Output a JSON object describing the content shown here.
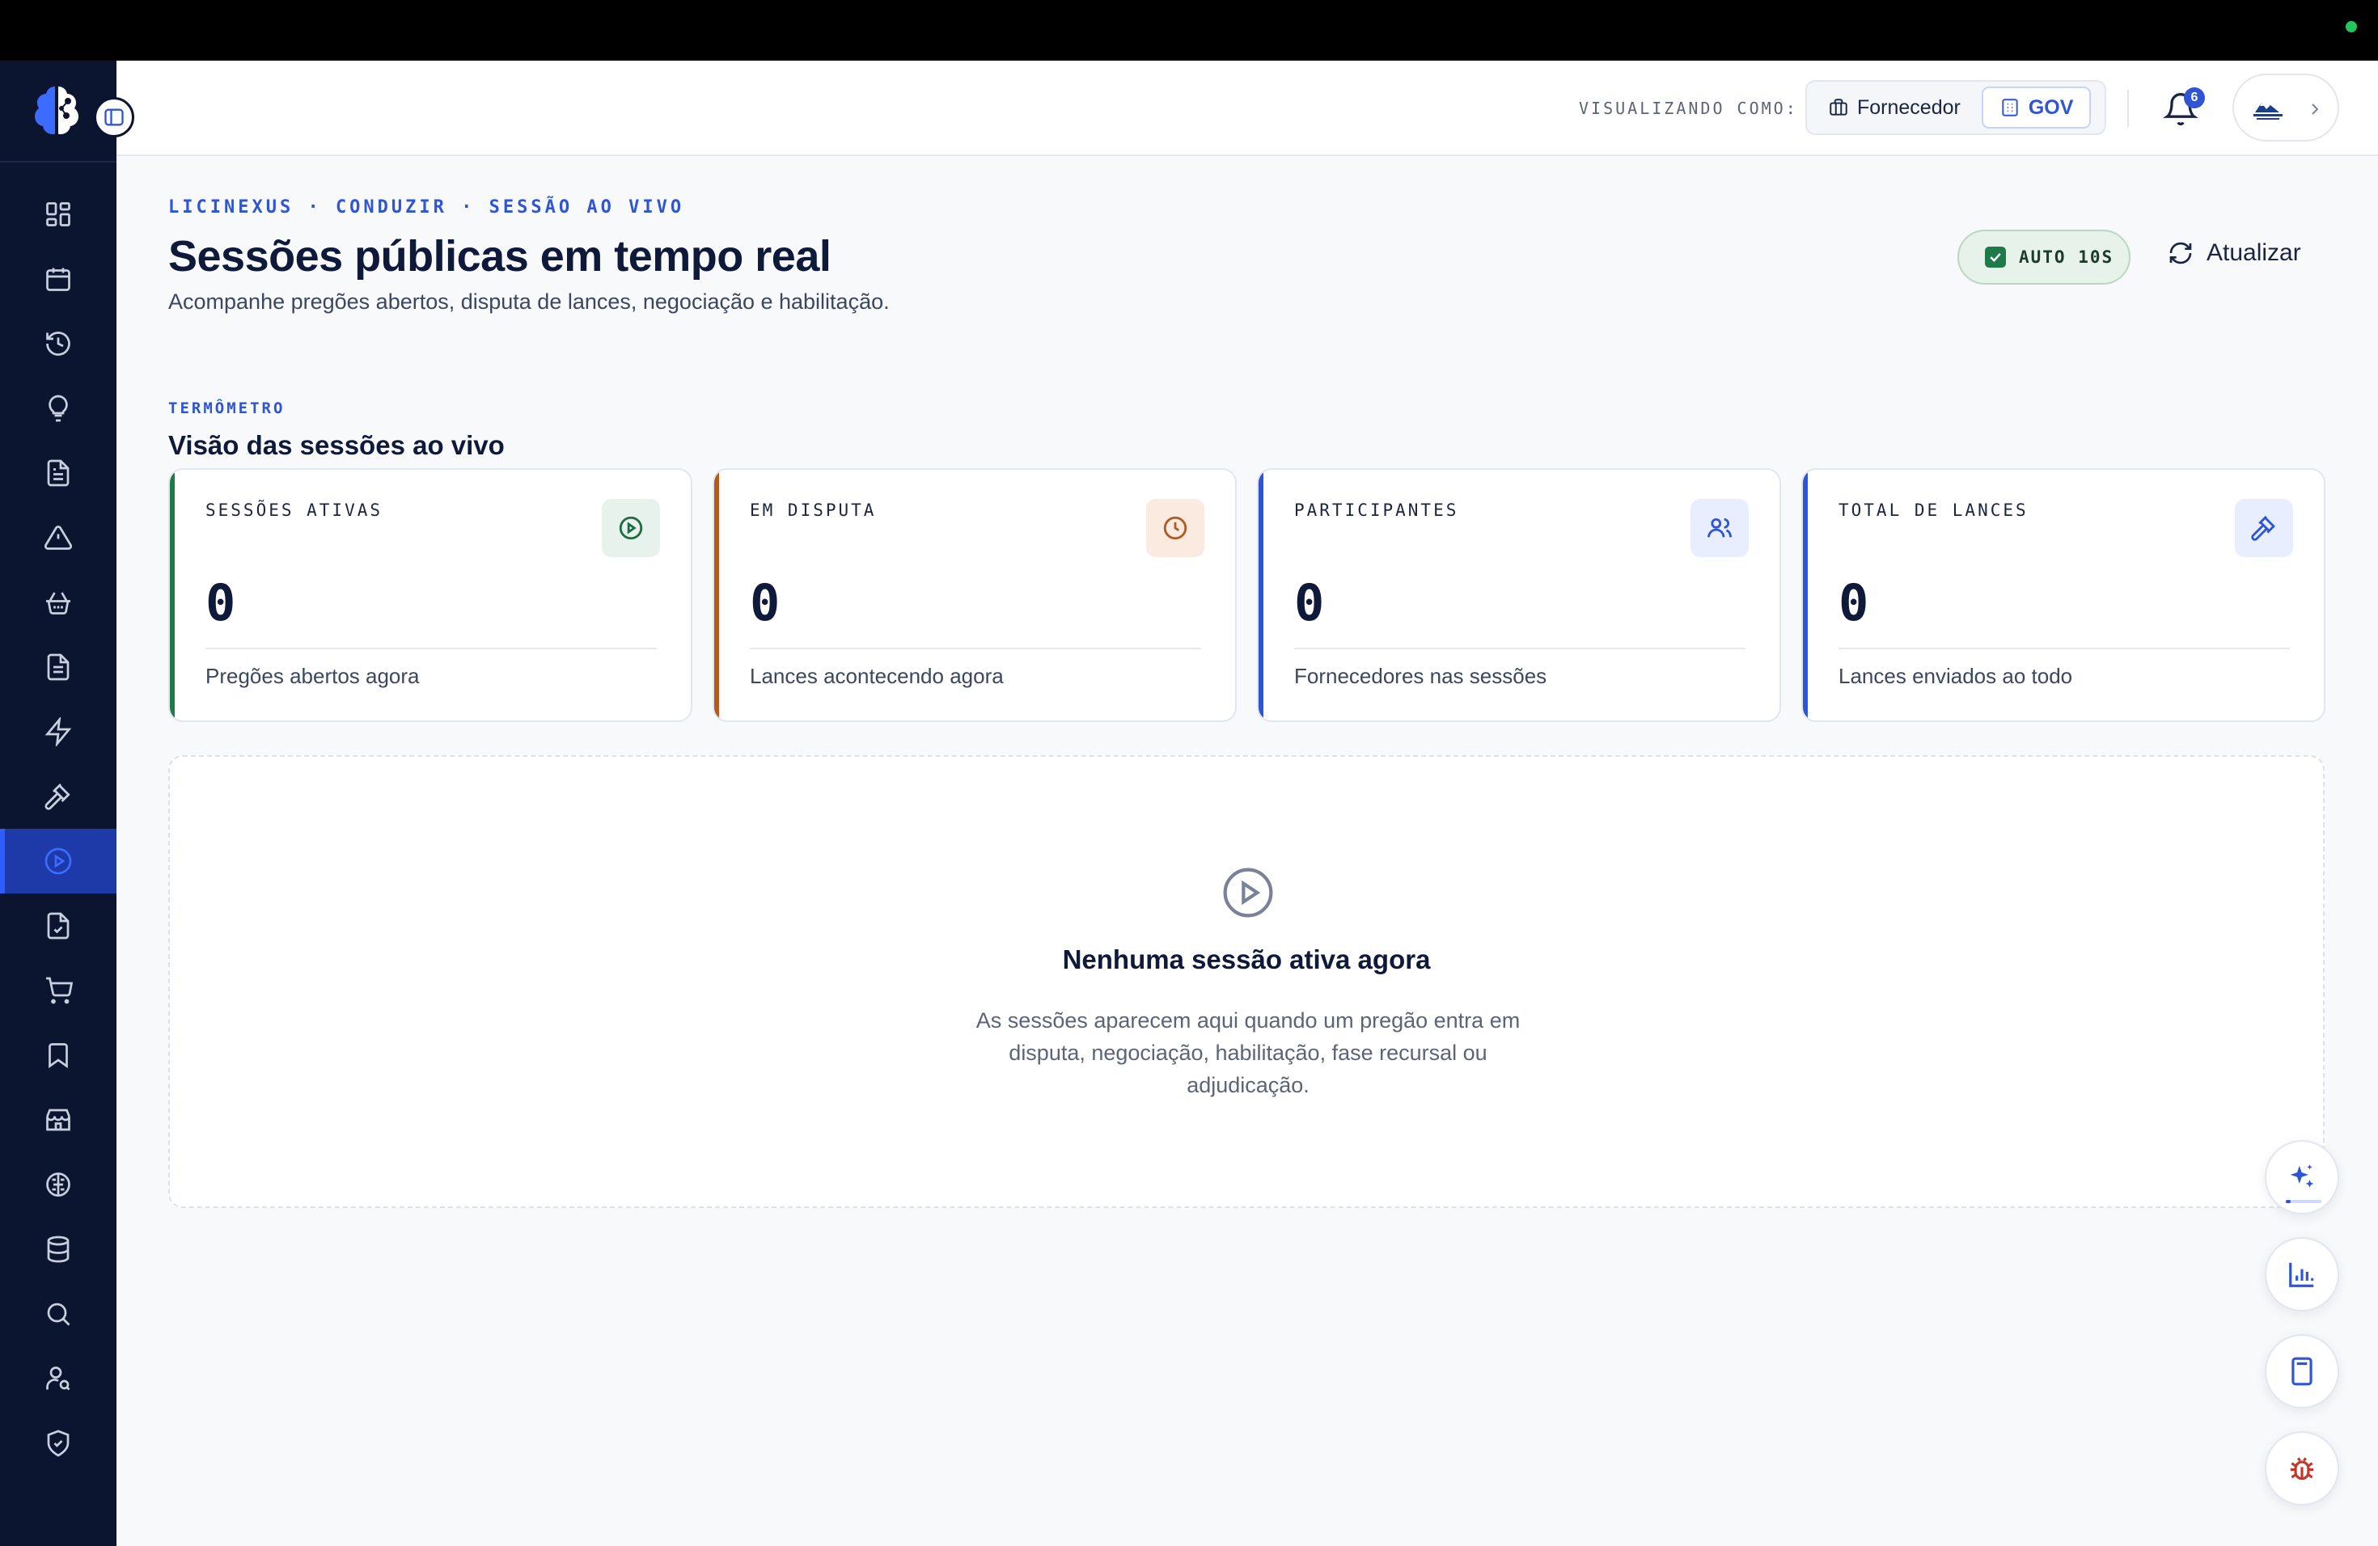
{
  "header": {
    "view_label": "VISUALIZANDO COMO:",
    "options": [
      {
        "label": "Fornecedor",
        "icon": "briefcase-icon"
      },
      {
        "label": "GOV",
        "icon": "building-icon"
      }
    ],
    "notification_count": "6"
  },
  "sidebar": {
    "items": [
      {
        "icon": "dashboard-icon"
      },
      {
        "icon": "calendar-icon"
      },
      {
        "icon": "history-icon"
      },
      {
        "icon": "lightbulb-icon"
      },
      {
        "icon": "document-icon"
      },
      {
        "icon": "alert-triangle-icon"
      },
      {
        "icon": "basket-icon"
      },
      {
        "icon": "file-text-icon"
      },
      {
        "icon": "lightning-icon"
      },
      {
        "icon": "gavel-icon"
      },
      {
        "icon": "play-circle-icon",
        "active": true
      },
      {
        "icon": "file-check-icon"
      },
      {
        "icon": "cart-icon"
      },
      {
        "icon": "bookmark-icon"
      },
      {
        "icon": "store-icon"
      },
      {
        "icon": "brain-icon"
      },
      {
        "icon": "database-icon"
      },
      {
        "icon": "search-icon"
      },
      {
        "icon": "user-search-icon"
      },
      {
        "icon": "shield-check-icon"
      }
    ]
  },
  "page": {
    "breadcrumb": "LICINEXUS · CONDUZIR · SESSÃO AO VIVO",
    "title": "Sessões públicas em tempo real",
    "subtitle": "Acompanhe pregões abertos, disputa de lances, negociação e habilitação.",
    "auto_label": "AUTO 10S",
    "refresh_label": "Atualizar"
  },
  "section": {
    "eyebrow": "TERMÔMETRO",
    "title": "Visão das sessões ao vivo"
  },
  "cards": [
    {
      "label": "SESSÕES ATIVAS",
      "value": "0",
      "desc": "Pregões abertos agora",
      "icon": "play-circle-icon",
      "accent": "#1f7a4a",
      "tint": "#e8f2ec",
      "iconColor": "#1f6b44"
    },
    {
      "label": "EM DISPUTA",
      "value": "0",
      "desc": "Lances acontecendo agora",
      "icon": "clock-icon",
      "accent": "#b35a1f",
      "tint": "#fbeae0",
      "iconColor": "#b35a1f"
    },
    {
      "label": "PARTICIPANTES",
      "value": "0",
      "desc": "Fornecedores nas sessões",
      "icon": "users-icon",
      "accent": "#2f55d4",
      "tint": "#e9eeff",
      "iconColor": "#2f55d4"
    },
    {
      "label": "TOTAL DE LANCES",
      "value": "0",
      "desc": "Lances enviados ao todo",
      "icon": "gavel-icon",
      "accent": "#2f55d4",
      "tint": "#e9eeff",
      "iconColor": "#2f55d4"
    }
  ],
  "empty": {
    "title": "Nenhuma sessão ativa agora",
    "description": "As sessões aparecem aqui quando um pregão entra em disputa, negociação, habilitação, fase recursal ou adjudicação."
  },
  "fabs": [
    {
      "icon": "sparkles-icon"
    },
    {
      "icon": "bar-chart-icon"
    },
    {
      "icon": "calculator-icon"
    },
    {
      "icon": "bug-icon"
    }
  ],
  "colors": {
    "sidebar": "#0b1530",
    "accent": "#2f55d4",
    "success": "#1f7a4a",
    "warning": "#b35a1f",
    "danger": "#c0392b"
  }
}
